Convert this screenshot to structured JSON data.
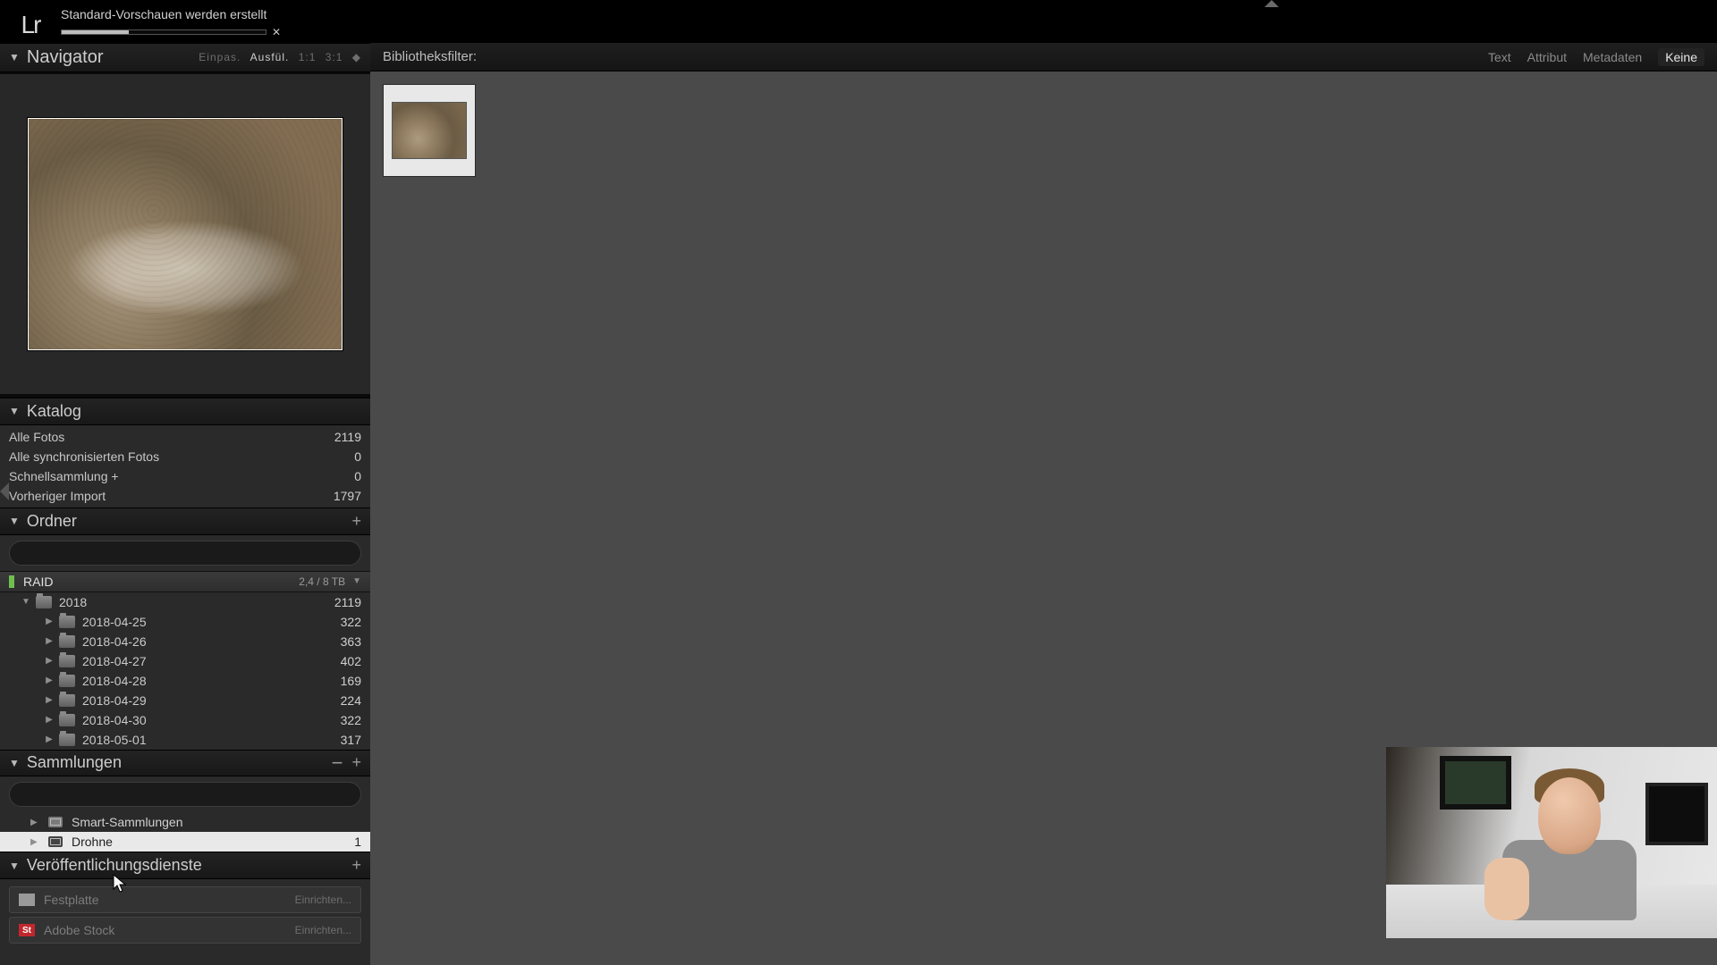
{
  "app": {
    "logo_text": "Lr"
  },
  "progress": {
    "label": "Standard-Vorschauen werden erstellt",
    "percent": 33
  },
  "navigator": {
    "title": "Navigator",
    "zoom": {
      "fit": "Einpas.",
      "fill": "Ausfül.",
      "one": "1:1",
      "ratio": "3:1"
    }
  },
  "katalog": {
    "title": "Katalog",
    "items": [
      {
        "label": "Alle Fotos",
        "count": "2119"
      },
      {
        "label": "Alle synchronisierten Fotos",
        "count": "0"
      },
      {
        "label": "Schnellsammlung  +",
        "count": "0"
      },
      {
        "label": "Vorheriger Import",
        "count": "1797"
      }
    ]
  },
  "ordner": {
    "title": "Ordner",
    "volume": {
      "name": "RAID",
      "capacity": "2,4 / 8 TB"
    },
    "root": {
      "name": "2018",
      "count": "2119"
    },
    "children": [
      {
        "name": "2018-04-25",
        "count": "322"
      },
      {
        "name": "2018-04-26",
        "count": "363"
      },
      {
        "name": "2018-04-27",
        "count": "402"
      },
      {
        "name": "2018-04-28",
        "count": "169"
      },
      {
        "name": "2018-04-29",
        "count": "224"
      },
      {
        "name": "2018-04-30",
        "count": "322"
      },
      {
        "name": "2018-05-01",
        "count": "317"
      }
    ]
  },
  "sammlungen": {
    "title": "Sammlungen",
    "items": [
      {
        "label": "Smart-Sammlungen",
        "count": "",
        "selected": false
      },
      {
        "label": "Drohne",
        "count": "1",
        "selected": true
      }
    ]
  },
  "publish": {
    "title": "Veröffentlichungsdienste",
    "services": [
      {
        "label": "Festplatte",
        "action": "Einrichten...",
        "icon": "hd"
      },
      {
        "label": "Adobe Stock",
        "action": "Einrichten...",
        "icon": "st",
        "badge": "St"
      }
    ]
  },
  "filterbar": {
    "title": "Bibliotheksfilter:",
    "opts": {
      "text": "Text",
      "attribut": "Attribut",
      "metadaten": "Metadaten",
      "keine": "Keine"
    }
  }
}
